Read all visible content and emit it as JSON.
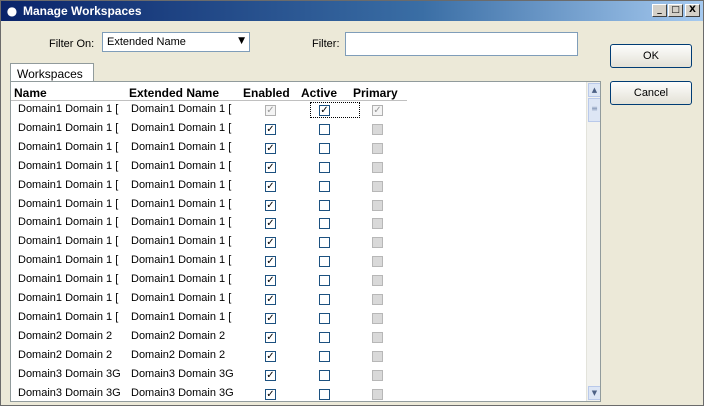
{
  "window": {
    "title": "Manage Workspaces",
    "minimize": "_",
    "maximize": "□",
    "close": "X"
  },
  "filter": {
    "on_label": "Filter On:",
    "on_value": "Extended Name",
    "label": "Filter:",
    "value": ""
  },
  "buttons": {
    "ok": "OK",
    "cancel": "Cancel"
  },
  "tab": "Workspaces",
  "columns": {
    "name": "Name",
    "extended": "Extended Name",
    "enabled": "Enabled",
    "active": "Active",
    "primary": "Primary"
  },
  "rows": [
    {
      "name": "Domain1 Domain 1 [",
      "extended": "Domain1 Domain 1 [",
      "enabled": true,
      "active": true,
      "primary": true,
      "first": true
    },
    {
      "name": "Domain1 Domain 1 [",
      "extended": "Domain1 Domain 1 [",
      "enabled": true,
      "active": false,
      "primary": false
    },
    {
      "name": "Domain1 Domain 1 [",
      "extended": "Domain1 Domain 1 [",
      "enabled": true,
      "active": false,
      "primary": false
    },
    {
      "name": "Domain1 Domain 1 [",
      "extended": "Domain1 Domain 1 [",
      "enabled": true,
      "active": false,
      "primary": false
    },
    {
      "name": "Domain1 Domain 1 [",
      "extended": "Domain1 Domain 1 [",
      "enabled": true,
      "active": false,
      "primary": false
    },
    {
      "name": "Domain1 Domain 1 [",
      "extended": "Domain1 Domain 1 [",
      "enabled": true,
      "active": false,
      "primary": false
    },
    {
      "name": "Domain1 Domain 1 [",
      "extended": "Domain1 Domain 1 [",
      "enabled": true,
      "active": false,
      "primary": false
    },
    {
      "name": "Domain1 Domain 1 [",
      "extended": "Domain1 Domain 1 [",
      "enabled": true,
      "active": false,
      "primary": false
    },
    {
      "name": "Domain1 Domain 1 [",
      "extended": "Domain1 Domain 1 [",
      "enabled": true,
      "active": false,
      "primary": false
    },
    {
      "name": "Domain1 Domain 1 [",
      "extended": "Domain1 Domain 1 [",
      "enabled": true,
      "active": false,
      "primary": false
    },
    {
      "name": "Domain1 Domain 1 [",
      "extended": "Domain1 Domain 1 [",
      "enabled": true,
      "active": false,
      "primary": false
    },
    {
      "name": "Domain1 Domain 1 [",
      "extended": "Domain1 Domain 1 [",
      "enabled": true,
      "active": false,
      "primary": false
    },
    {
      "name": "Domain2 Domain 2",
      "extended": "Domain2 Domain 2",
      "enabled": true,
      "active": false,
      "primary": false
    },
    {
      "name": "Domain2 Domain 2",
      "extended": "Domain2 Domain 2",
      "enabled": true,
      "active": false,
      "primary": false
    },
    {
      "name": "Domain3 Domain 3G",
      "extended": "Domain3 Domain 3G",
      "enabled": true,
      "active": false,
      "primary": false
    },
    {
      "name": "Domain3 Domain 3G",
      "extended": "Domain3 Domain 3G",
      "enabled": true,
      "active": false,
      "primary": false
    }
  ],
  "icons": {
    "title": "app-icon",
    "scroll_up": "up-arrow-icon",
    "scroll_down": "down-arrow-icon",
    "dropdown": "chevron-down-icon"
  }
}
